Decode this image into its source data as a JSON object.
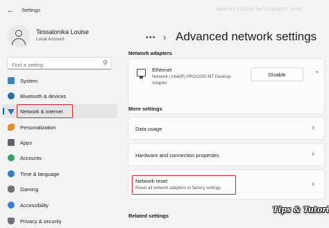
{
  "window": {
    "title": "Settings",
    "watermark": "mastertipsorialbogspot.com",
    "corner_logo": "Tips & Tutorial"
  },
  "user": {
    "name": "Tessalonika Louise",
    "account_type": "Local Account"
  },
  "search": {
    "placeholder": "Find a setting"
  },
  "nav": [
    {
      "label": "System",
      "icon": "monitor-icon",
      "color": "#3b82c4"
    },
    {
      "label": "Bluetooth & devices",
      "icon": "bluetooth-icon",
      "color": "#1f6fb5"
    },
    {
      "label": "Network & internet",
      "icon": "wifi-icon",
      "color": "#2a6fc0",
      "selected": true
    },
    {
      "label": "Personalization",
      "icon": "brush-icon",
      "color": "#e0902a"
    },
    {
      "label": "Apps",
      "icon": "apps-icon",
      "color": "#5a6270"
    },
    {
      "label": "Accounts",
      "icon": "person-icon",
      "color": "#2fa36b"
    },
    {
      "label": "Time & language",
      "icon": "globe-clock-icon",
      "color": "#2d7fc9"
    },
    {
      "label": "Gaming",
      "icon": "gamepad-icon",
      "color": "#6b7280"
    },
    {
      "label": "Accessibility",
      "icon": "accessibility-icon",
      "color": "#3a7bd5"
    },
    {
      "label": "Privacy & security",
      "icon": "shield-icon",
      "color": "#6b7280"
    }
  ],
  "main": {
    "breadcrumb_dots": "•••",
    "page_title": "Advanced network settings",
    "sections": {
      "adapters": "Network adapters",
      "more": "More settings",
      "related": "Related settings"
    },
    "adapter": {
      "name": "Ethernet",
      "description_line1": "Network | Intel(R) PRO/1000 MT Desktop",
      "description_line2": "Adapter",
      "button": "Disable"
    },
    "more_settings": [
      {
        "title": "Data usage"
      },
      {
        "title": "Hardware and connection properties"
      },
      {
        "title": "Network reset",
        "subtitle": "Reset all network adapters to factory settings"
      }
    ]
  }
}
